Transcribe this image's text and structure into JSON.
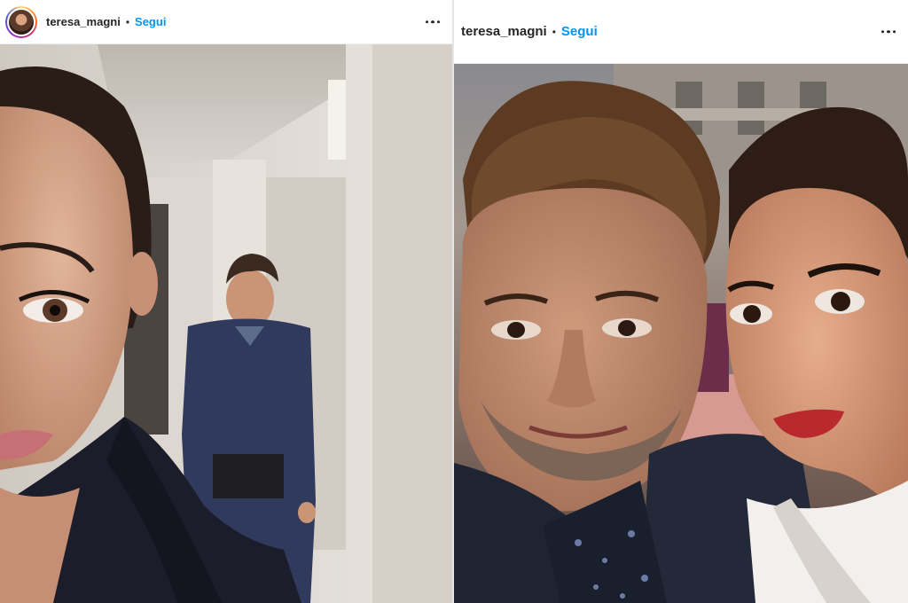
{
  "posts": [
    {
      "username": "teresa_magni",
      "separator": "•",
      "follow_label": "Segui",
      "avatar_icon": "profile-photo",
      "more_icon": "more-options-icon"
    },
    {
      "username": "teresa_magni",
      "separator": "•",
      "follow_label": "Segui",
      "more_icon": "more-options-icon"
    }
  ],
  "colors": {
    "follow_blue": "#0095f6",
    "text_dark": "#262626"
  }
}
